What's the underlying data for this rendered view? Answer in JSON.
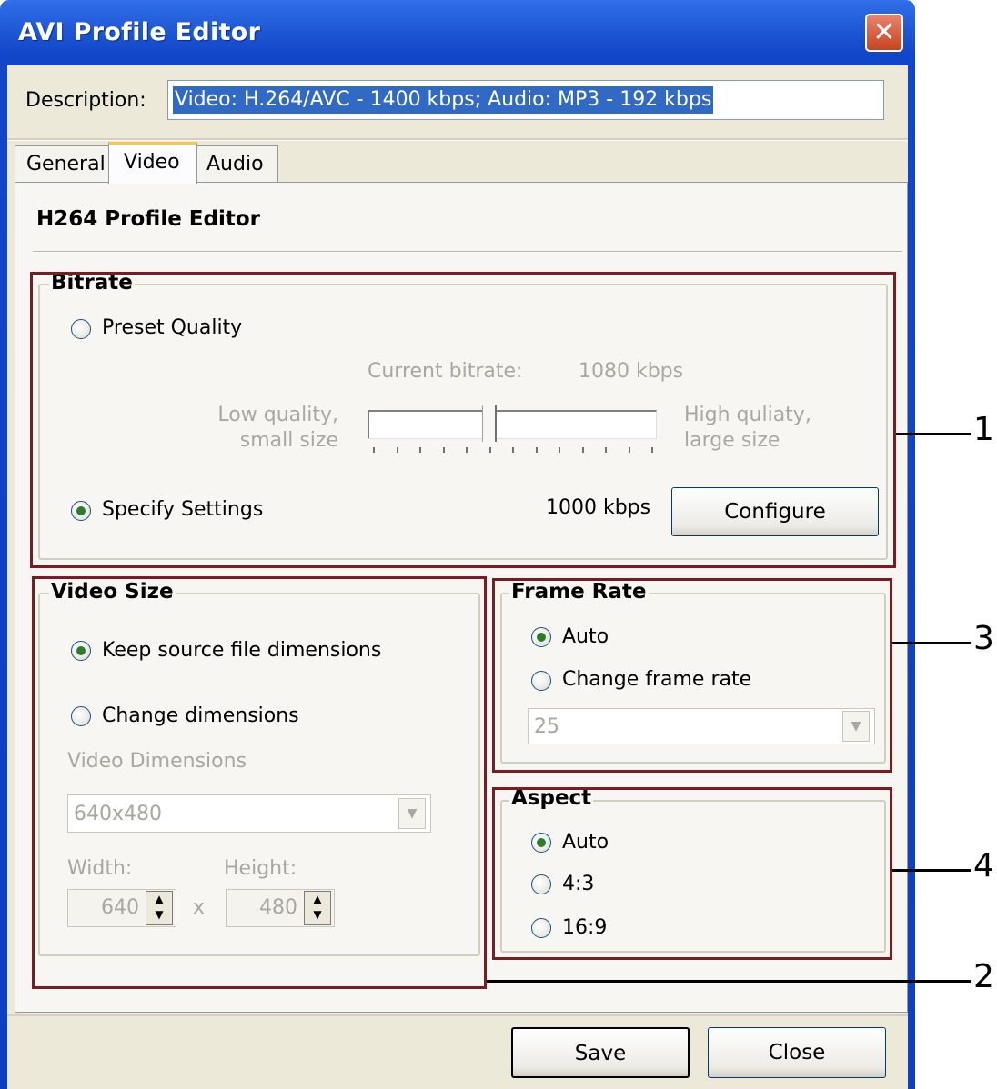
{
  "window": {
    "title": "AVI Profile Editor",
    "close_icon": "close-icon"
  },
  "description": {
    "label": "Description:",
    "value": "Video: H.264/AVC - 1400 kbps; Audio: MP3 - 192 kbps"
  },
  "tabs": [
    {
      "label": "General",
      "selected": false
    },
    {
      "label": "Video",
      "selected": true
    },
    {
      "label": "Audio",
      "selected": false
    }
  ],
  "section_title": "H264 Profile Editor",
  "bitrate": {
    "title": "Bitrate",
    "preset_quality_label": "Preset Quality",
    "preset_quality_selected": false,
    "current_bitrate_label": "Current bitrate:",
    "current_bitrate_value": "1080 kbps",
    "low_quality_line1": "Low quality,",
    "low_quality_line2": "small size",
    "high_quality_line1": "High quliaty,",
    "high_quality_line2": "large size",
    "slider_fraction": 0.42,
    "specify_settings_label": "Specify Settings",
    "specify_settings_selected": true,
    "specified_value": "1000 kbps",
    "configure_label": "Configure"
  },
  "video_size": {
    "title": "Video Size",
    "keep_source_label": "Keep source file dimensions",
    "keep_source_selected": true,
    "change_dimensions_label": "Change dimensions",
    "change_dimensions_selected": false,
    "dimensions_label": "Video Dimensions",
    "dimensions_value": "640x480",
    "width_label": "Width:",
    "width_value": "640",
    "height_label": "Height:",
    "height_value": "480",
    "times_sign": "x"
  },
  "frame_rate": {
    "title": "Frame Rate",
    "auto_label": "Auto",
    "auto_selected": true,
    "change_label": "Change frame rate",
    "change_selected": false,
    "rate_value": "25"
  },
  "aspect": {
    "title": "Aspect",
    "options": [
      {
        "label": "Auto",
        "selected": true
      },
      {
        "label": "4:3",
        "selected": false
      },
      {
        "label": "16:9",
        "selected": false
      }
    ]
  },
  "footer": {
    "save_label": "Save",
    "close_label": "Close"
  },
  "callouts": [
    "1",
    "2",
    "3",
    "4"
  ],
  "colors": {
    "title_bar": "#1246c8",
    "highlight_box": "#7b1c22",
    "selection": "#316ac5",
    "dialog_bg": "#ece9d8"
  }
}
